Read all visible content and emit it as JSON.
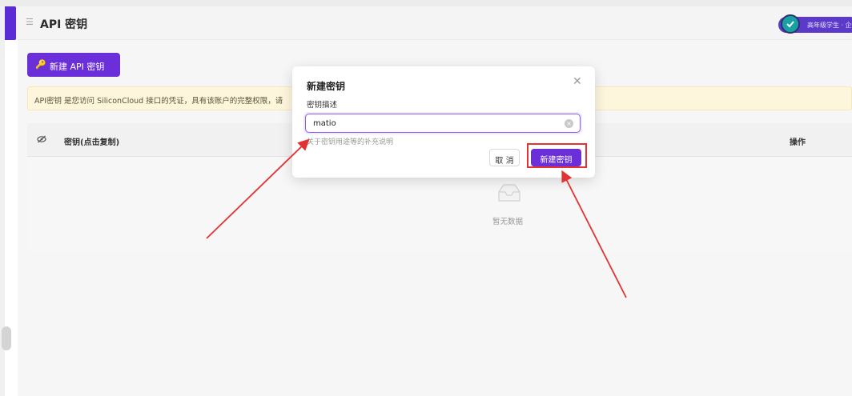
{
  "header": {
    "title": "API 密钥",
    "user_badge": "高年级学生 · 企业"
  },
  "toolbar": {
    "new_key_label": "新建 API 密钥"
  },
  "notice": {
    "text": "API密钥 是您访问 SiliconCloud 接口的凭证，具有该账户的完整权限，请"
  },
  "table": {
    "columns": [
      "密钥(点击复制)",
      "操作"
    ],
    "empty_text": "暂无数据"
  },
  "modal": {
    "title": "新建密钥",
    "field_label": "密钥描述",
    "field_value": "matio",
    "field_help": "关于密钥用途等的补充说明",
    "cancel_label": "取 消",
    "create_label": "新建密钥"
  },
  "icons": {
    "menu": "menu-icon",
    "key": "key-icon",
    "eye": "eye-off-icon",
    "close": "close-icon",
    "clear": "clear-icon",
    "empty": "empty-box-icon",
    "verified": "check-circle-icon"
  },
  "colors": {
    "brand": "#6a2fd8",
    "notice_bg": "#fdf6dd",
    "annotation": "#e33232"
  }
}
